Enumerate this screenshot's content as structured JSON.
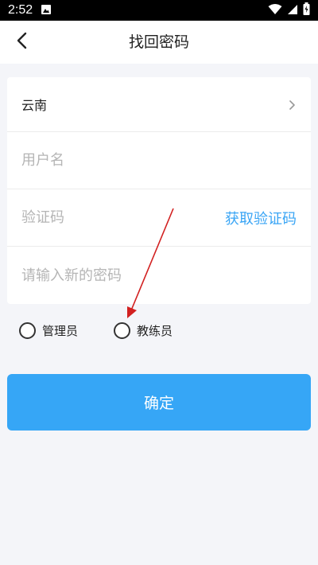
{
  "status_bar": {
    "time": "2:52",
    "icons": [
      "image-icon",
      "wifi-icon",
      "signal-icon",
      "battery-icon"
    ]
  },
  "header": {
    "title": "找回密码",
    "back_icon": "back-arrow-icon"
  },
  "form": {
    "region": {
      "value": "云南",
      "icon": "chevron-right-icon"
    },
    "username": {
      "placeholder": "用户名",
      "value": ""
    },
    "verification_code": {
      "placeholder": "验证码",
      "value": "",
      "get_code_label": "获取验证码"
    },
    "new_password": {
      "placeholder": "请输入新的密码",
      "value": ""
    }
  },
  "roles": {
    "options": [
      {
        "label": "管理员",
        "selected": false
      },
      {
        "label": "教练员",
        "selected": false
      }
    ]
  },
  "confirm_button": {
    "label": "确定"
  },
  "colors": {
    "accent": "#36a6f6",
    "link": "#3aa5f5",
    "background": "#f4f5f9",
    "annotation": "#d22020"
  }
}
